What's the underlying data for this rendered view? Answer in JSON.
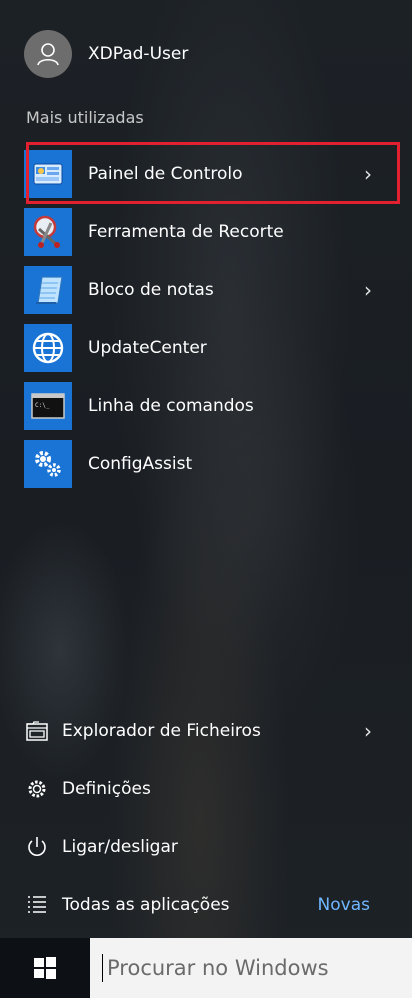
{
  "user": {
    "name": "XDPad-User"
  },
  "section_title": "Mais utilizadas",
  "apps": [
    {
      "label": "Painel de Controlo",
      "icon": "control-panel-icon",
      "has_submenu": true
    },
    {
      "label": "Ferramenta de Recorte",
      "icon": "snipping-tool-icon",
      "has_submenu": false
    },
    {
      "label": "Bloco de notas",
      "icon": "notepad-icon",
      "has_submenu": true
    },
    {
      "label": "UpdateCenter",
      "icon": "globe-icon",
      "has_submenu": false
    },
    {
      "label": "Linha de comandos",
      "icon": "command-prompt-icon",
      "has_submenu": false
    },
    {
      "label": "ConfigAssist",
      "icon": "gears-icon",
      "has_submenu": false
    }
  ],
  "bottom": [
    {
      "label": "Explorador de Ficheiros",
      "icon": "file-explorer-icon",
      "has_submenu": true
    },
    {
      "label": "Definições",
      "icon": "settings-gear-icon",
      "has_submenu": false
    },
    {
      "label": "Ligar/desligar",
      "icon": "power-icon",
      "has_submenu": false
    },
    {
      "label": "Todas as aplicações",
      "icon": "all-apps-list-icon",
      "badge": "Novas"
    }
  ],
  "search": {
    "placeholder": "Procurar no Windows"
  },
  "colors": {
    "tile": "#1a74d6",
    "highlight": "#e2202f",
    "badge": "#6fb7ff"
  }
}
